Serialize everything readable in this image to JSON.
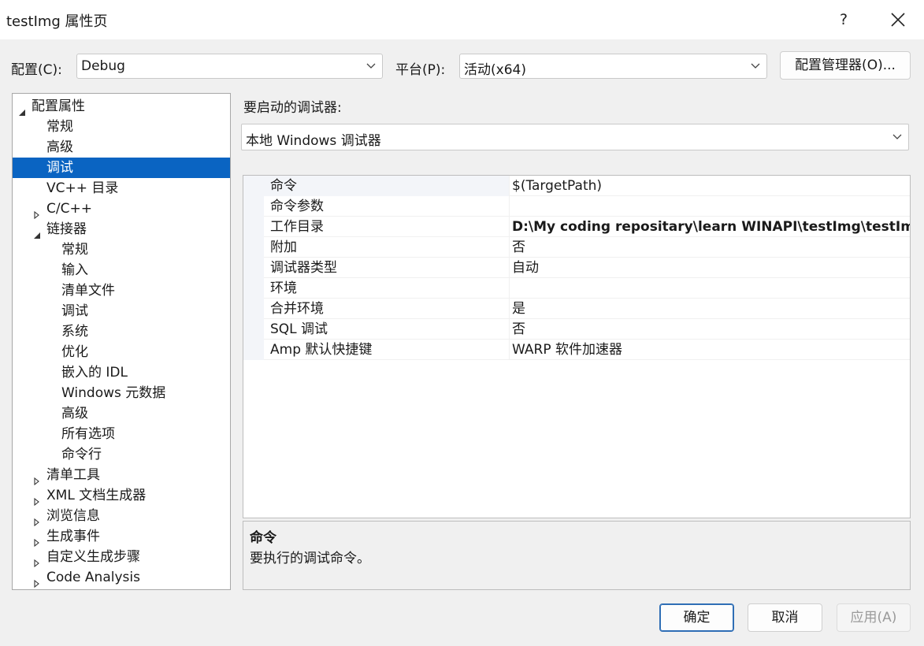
{
  "window": {
    "title": "testImg 属性页",
    "help": "?"
  },
  "config": {
    "label": "配置(C):",
    "value": "Debug"
  },
  "platform": {
    "label": "平台(P):",
    "value": "活动(x64)"
  },
  "config_manager_label": "配置管理器(O)...",
  "tree": [
    {
      "label": "配置属性",
      "toggle": "expanded",
      "level": 0
    },
    {
      "label": "常规",
      "toggle": "none",
      "level": 1
    },
    {
      "label": "高级",
      "toggle": "none",
      "level": 1
    },
    {
      "label": "调试",
      "toggle": "none",
      "level": 1,
      "selected": true
    },
    {
      "label": "VC++ 目录",
      "toggle": "none",
      "level": 1
    },
    {
      "label": "C/C++",
      "toggle": "collapsed",
      "level": 1
    },
    {
      "label": "链接器",
      "toggle": "expanded",
      "level": 1
    },
    {
      "label": "常规",
      "toggle": "none",
      "level": 2
    },
    {
      "label": "输入",
      "toggle": "none",
      "level": 2
    },
    {
      "label": "清单文件",
      "toggle": "none",
      "level": 2
    },
    {
      "label": "调试",
      "toggle": "none",
      "level": 2
    },
    {
      "label": "系统",
      "toggle": "none",
      "level": 2
    },
    {
      "label": "优化",
      "toggle": "none",
      "level": 2
    },
    {
      "label": "嵌入的 IDL",
      "toggle": "none",
      "level": 2
    },
    {
      "label": "Windows 元数据",
      "toggle": "none",
      "level": 2
    },
    {
      "label": "高级",
      "toggle": "none",
      "level": 2
    },
    {
      "label": "所有选项",
      "toggle": "none",
      "level": 2
    },
    {
      "label": "命令行",
      "toggle": "none",
      "level": 2
    },
    {
      "label": "清单工具",
      "toggle": "collapsed",
      "level": 1
    },
    {
      "label": "XML 文档生成器",
      "toggle": "collapsed",
      "level": 1
    },
    {
      "label": "浏览信息",
      "toggle": "collapsed",
      "level": 1
    },
    {
      "label": "生成事件",
      "toggle": "collapsed",
      "level": 1
    },
    {
      "label": "自定义生成步骤",
      "toggle": "collapsed",
      "level": 1
    },
    {
      "label": "Code Analysis",
      "toggle": "collapsed",
      "level": 1
    }
  ],
  "debugger": {
    "label": "要启动的调试器:",
    "value": "本地 Windows 调试器"
  },
  "properties": [
    {
      "name": "命令",
      "value": "$(TargetPath)",
      "bold": false
    },
    {
      "name": "命令参数",
      "value": "",
      "bold": false
    },
    {
      "name": "工作目录",
      "value": "D:\\My coding repositary\\learn WINAPI\\testImg\\testImg\\",
      "bold": true
    },
    {
      "name": "附加",
      "value": "否",
      "bold": false
    },
    {
      "name": "调试器类型",
      "value": "自动",
      "bold": false
    },
    {
      "name": "环境",
      "value": "",
      "bold": false
    },
    {
      "name": "合并环境",
      "value": "是",
      "bold": false
    },
    {
      "name": "SQL 调试",
      "value": "否",
      "bold": false
    },
    {
      "name": "Amp 默认快捷键",
      "value": "WARP 软件加速器",
      "bold": false
    }
  ],
  "description": {
    "title": "命令",
    "text": "要执行的调试命令。"
  },
  "buttons": {
    "ok": "确定",
    "cancel": "取消",
    "apply": "应用(A)"
  },
  "colors": {
    "selection": "#0a64c2",
    "dialog_bg": "#f0f0f0",
    "ok_border": "#2f6eb5"
  }
}
